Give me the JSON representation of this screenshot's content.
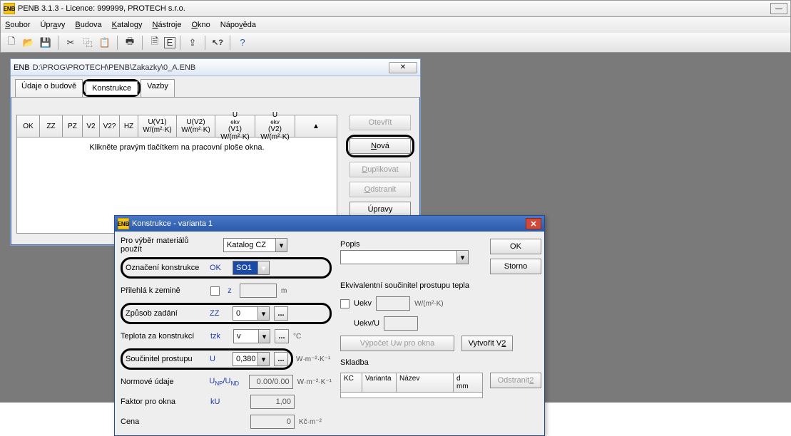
{
  "app": {
    "title": "PENB 3.1.3  -  Licence: 999999,  PROTECH s.r.o."
  },
  "menu": {
    "items": [
      "Soubor",
      "Úpravy",
      "Budova",
      "Katalogy",
      "Nástroje",
      "Okno",
      "Nápověda"
    ]
  },
  "toolbar": {
    "icons": [
      "file-new-icon",
      "file-open-icon",
      "file-save-icon",
      "cut-icon",
      "copy-icon",
      "paste-icon",
      "print-icon",
      "preview-icon",
      "table-icon",
      "export-icon",
      "help-icon",
      "about-icon"
    ]
  },
  "mdi": {
    "title": "D:\\PROG\\PROTECH\\PENB\\Zakazky\\0_A.ENB",
    "tabs": [
      "Údaje o budově",
      "Konstrukce",
      "Vazby"
    ],
    "active_tab": 1,
    "grid": {
      "headers": [
        "OK",
        "ZZ",
        "PZ",
        "V2",
        "V2?",
        "HZ",
        "U(V1)\nW/(m²·K)",
        "U(V2)\nW/(m²·K)",
        "Uekv(V1)\nW/(m²·K)",
        "Uekv(V2)\nW/(m²·K)"
      ],
      "empty_msg": "Klikněte pravým tlačítkem na pracovní ploše okna."
    },
    "buttons": {
      "open": "Otevřít",
      "new": "Nová",
      "duplicate": "Duplikovat",
      "delete": "Odstranit",
      "edit": "Úpravy"
    }
  },
  "dlg": {
    "title": "Konstrukce - varianta 1",
    "left": {
      "material_label": "Pro výběr materiálů použít",
      "material_sel": "Katalog CZ",
      "oznaceni_label": "Označení konstrukce",
      "oznaceni_sym": "OK",
      "oznaceni_val": "SO1",
      "prilehla_label": "Přilehlá k zemině",
      "prilehla_sym": "z",
      "prilehla_val": "",
      "prilehla_unit": "m",
      "zpusob_label": "Způsob zadání",
      "zpusob_sym": "ZZ",
      "zpusob_val": "0",
      "teplota_label": "Teplota za konstrukcí",
      "teplota_sym": "tzk",
      "teplota_val": "v",
      "teplota_unit": "°C",
      "soucinitel_label": "Součinitel prostupu",
      "soucinitel_sym": "U",
      "soucinitel_val": "0,380",
      "soucinitel_unit": "W·m⁻²·K⁻¹",
      "normove_label": "Normové údaje",
      "normove_sym": "UNP/UND",
      "normove_val": "0.00/0.00",
      "normove_unit": "W·m⁻²·K⁻¹",
      "faktor_label": "Faktor pro okna",
      "faktor_sym": "kU",
      "faktor_val": "1,00",
      "cena_label": "Cena",
      "cena_val": "0",
      "cena_unit": "Kč·m⁻²"
    },
    "right": {
      "popis_label": "Popis",
      "popis_val": "",
      "ekv_label": "Ekvivalentní součinitel prostupu tepla",
      "uekv_label": "Uekv",
      "uekv_val": "",
      "uekv_unit": "W/(m²·K)",
      "uekvu_label": "Uekv/U",
      "uekvu_val": "",
      "calc_btn": "Výpočet Uw pro okna",
      "v2_btn": "Vytvořit V2",
      "skladba_label": "Skladba",
      "table_headers": [
        "KC",
        "Varianta",
        "Název",
        "d\nmm"
      ],
      "del2_btn": "Odstranit 2",
      "ok_btn": "OK",
      "cancel_btn": "Storno"
    }
  }
}
